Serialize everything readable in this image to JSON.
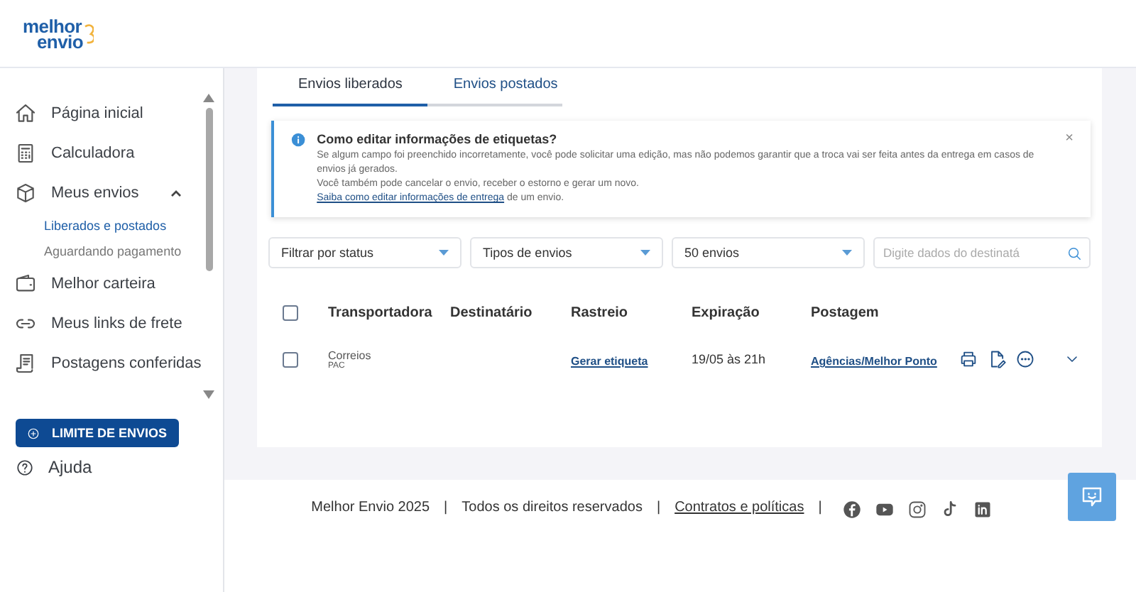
{
  "logo": {
    "line_1": "melhor",
    "line_2": "envio"
  },
  "sidebar": {
    "items": [
      {
        "label": "Página inicial"
      },
      {
        "label": "Calculadora"
      },
      {
        "label": "Meus envios",
        "expanded": true,
        "children": [
          {
            "label": "Liberados e postados",
            "selected": true
          },
          {
            "label": "Aguardando pagamento",
            "selected": false
          }
        ]
      },
      {
        "label": "Melhor carteira"
      },
      {
        "label": "Meus links de frete"
      },
      {
        "label": "Postagens conferidas"
      }
    ],
    "limit_button": "LIMITE DE ENVIOS",
    "help": "Ajuda"
  },
  "tabs": [
    {
      "label": "Envios liberados",
      "selected": true
    },
    {
      "label": "Envios postados",
      "selected": false
    }
  ],
  "alert": {
    "title": "Como editar informações de etiquetas?",
    "lines": [
      "Se algum campo foi preenchido incorretamente, você pode solicitar uma edição, mas não podemos garantir que a troca vai ser feita antes da entrega em casos de envios já gerados.",
      "Você também pode cancelar o envio, receber o estorno e gerar um novo."
    ],
    "link": "Saiba como editar informações de entrega",
    "link_after": " de um envio.",
    "close": "×"
  },
  "filters": {
    "selects": [
      "Filtrar por status",
      "Tipos de envios",
      "50 envios"
    ],
    "search": {
      "placeholder": "Digite dados do destinatá"
    }
  },
  "table": {
    "columns": [
      "Transportadora",
      "Destinatário",
      "Rastreio",
      "Expiração",
      "Postagem"
    ],
    "header_checked": false,
    "rows": [
      {
        "checked": false,
        "carrier": "Correios",
        "service": "PAC",
        "tracking": "Gerar etiqueta",
        "expiration": "19/05 às 21h",
        "posting": "Agências/Melhor Ponto"
      }
    ]
  },
  "footer": {
    "copyright": "Melhor Envio 2025",
    "rights": "Todos os direitos reservados",
    "link": "Contratos e políticas",
    "separators": [
      "|",
      "|",
      "|"
    ]
  }
}
